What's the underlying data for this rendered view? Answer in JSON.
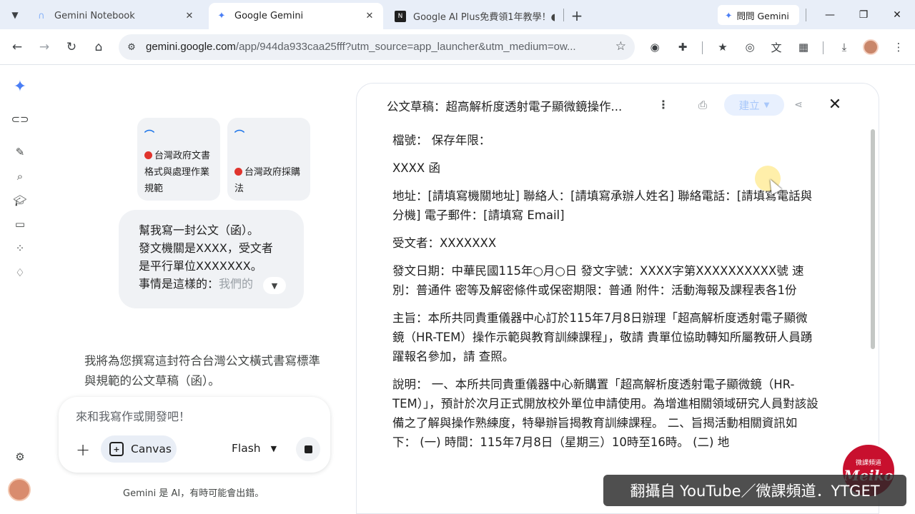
{
  "browser": {
    "tabs": [
      {
        "title": "Gemini Notebook",
        "active": false
      },
      {
        "title": "Google Gemini",
        "active": true
      },
      {
        "title": "Google AI Plus免費領1年教學！●",
        "active": false
      }
    ],
    "ask_gemini_label": "問問 Gemini",
    "url_host": "gemini.google.com",
    "url_rest": "/app/944da933caa25fff?utm_source=app_launcher&utm_medium=ow..."
  },
  "chat": {
    "source_cards": [
      {
        "text": "台灣政府文書格式與處理作業規範"
      },
      {
        "text": "台灣政府採購法"
      }
    ],
    "user_message": {
      "line1": "幫我寫一封公文（函）。",
      "line2": "發文機關是XXXX，受文者",
      "line3": "是平行單位XXXXXXX。",
      "line4_main": "事情是這樣的：",
      "line4_fade": "我們的"
    },
    "response_text": "我將為您撰寫這封符合台灣公文橫式書寫標準與規範的公文草稿（函）。",
    "input": {
      "placeholder": "來和我寫作或開發吧！",
      "canvas_label": "Canvas",
      "model_label": "Flash"
    },
    "disclaimer": "Gemini 是 AI，有時可能會出錯。"
  },
  "document": {
    "title": "公文草稿：超高解析度透射電子顯微鏡操作...",
    "create_label": "建立",
    "paragraphs": [
      "檔號： 保存年限：",
      "XXXX 函",
      "地址：[請填寫機關地址] 聯絡人：[請填寫承辦人姓名] 聯絡電話：[請填寫電話與分機] 電子郵件：[請填寫 Email]",
      "受文者：XXXXXXX",
      "發文日期：中華民國115年○月○日 發文字號：XXXX字第XXXXXXXXXX號 速別：普通件 密等及解密條件或保密期限：普通 附件：活動海報及課程表各1份",
      "主旨：本所共同貴重儀器中心訂於115年7月8日辦理「超高解析度透射電子顯微鏡（HR-TEM）操作示範與教育訓練課程」，敬請 貴單位協助轉知所屬教研人員踴躍報名參加，請 查照。",
      "說明： 一、本所共同貴重儀器中心新購置「超高解析度透射電子顯微鏡（HR-TEM）」，預計於次月正式開放校外單位申請使用。為增進相關領域研究人員對該設備之了解與操作熟練度，特舉辦旨揭教育訓練課程。 二、旨揭活動相關資訊如下： (一) 時間：115年7月8日（星期三）10時至16時。 (二) 地"
    ]
  },
  "watermark": {
    "badge_small": "微課頻道",
    "badge_big": "Meiko",
    "banner": "翻攝自 YouTube／微課頻道．YTGET"
  },
  "colors": {
    "tabbar_bg": "#e8eef8",
    "accent_blue": "#1a73e8",
    "create_button_bg": "#e8f0fe",
    "badge_red": "#c8102e"
  },
  "icons": [
    "chevron-down-icon",
    "gemini-sparkle-icon",
    "close-icon",
    "plus-icon",
    "back-arrow-icon",
    "forward-arrow-icon",
    "reload-icon",
    "home-icon",
    "site-settings-icon",
    "bookmark-star-icon",
    "extension-icon",
    "download-icon",
    "print-icon",
    "share-icon",
    "more-vert-icon",
    "settings-gear-icon"
  ]
}
